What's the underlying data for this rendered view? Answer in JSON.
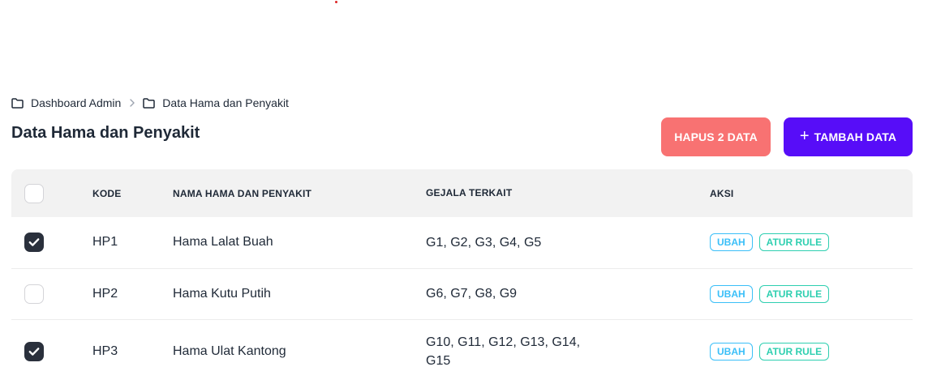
{
  "breadcrumb": {
    "items": [
      {
        "label": "Dashboard Admin",
        "icon": "folder-icon"
      },
      {
        "label": "Data Hama dan Penyakit",
        "icon": "folder-icon"
      }
    ],
    "separator_icon": "chevron-right-icon"
  },
  "page": {
    "title": "Data Hama dan Penyakit"
  },
  "actions": {
    "delete_label": "HAPUS 2 DATA",
    "add_label": "TAMBAH DATA",
    "add_icon": "plus-icon",
    "delete_color": "#f87272",
    "add_color": "#570df8"
  },
  "table": {
    "columns": {
      "kode": "KODE",
      "nama": "NAMA HAMA DAN PENYAKIT",
      "gejala": "GEJALA TERKAIT",
      "aksi": "AKSI"
    },
    "select_all_checked": false,
    "rows": [
      {
        "checked": true,
        "kode": "HP1",
        "nama": "Hama Lalat Buah",
        "gejala": "G1, G2, G3, G4, G5",
        "edit_label": "UBAH",
        "rule_label": "ATUR RULE"
      },
      {
        "checked": false,
        "kode": "HP2",
        "nama": "Hama Kutu Putih",
        "gejala": "G6, G7, G8, G9",
        "edit_label": "UBAH",
        "rule_label": "ATUR RULE"
      },
      {
        "checked": true,
        "kode": "HP3",
        "nama": "Hama Ulat Kantong",
        "gejala": "G10, G11, G12, G13, G14, G15",
        "edit_label": "UBAH",
        "rule_label": "ATUR RULE"
      }
    ]
  }
}
